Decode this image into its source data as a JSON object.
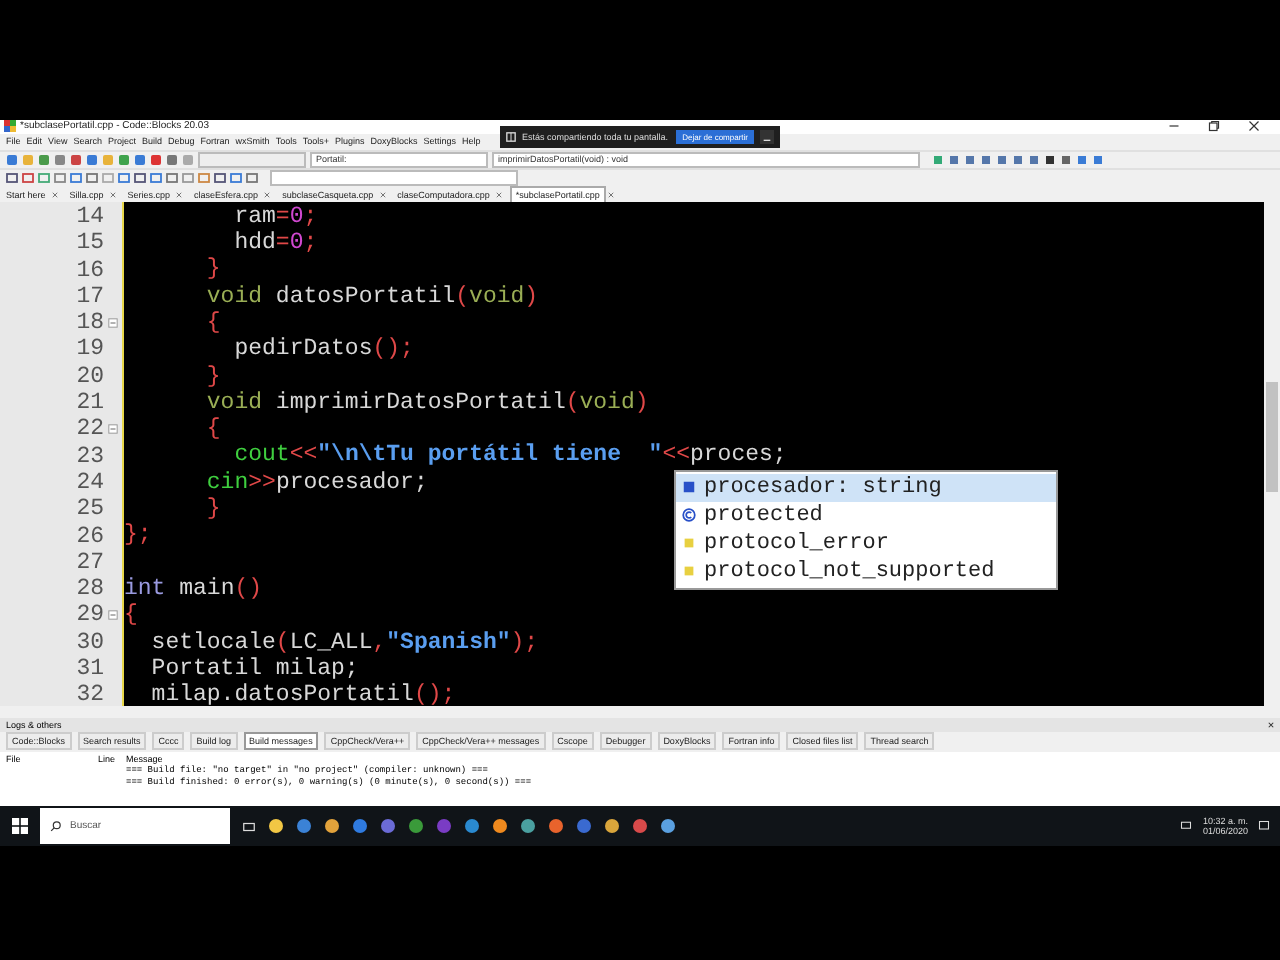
{
  "share_banner": {
    "message": "Estás compartiendo toda tu pantalla.",
    "stop_button": "Dejar de compartir"
  },
  "window": {
    "title": "*subclasePortatil.cpp - Code::Blocks 20.03"
  },
  "menu": [
    "File",
    "Edit",
    "View",
    "Search",
    "Project",
    "Build",
    "Debug",
    "Fortran",
    "wxSmith",
    "Tools",
    "Tools+",
    "Plugins",
    "DoxyBlocks",
    "Settings",
    "Help"
  ],
  "toolbar": {
    "scope": "Portatil:",
    "symbol": "imprimirDatosPortatil(void) : void"
  },
  "tabs": [
    {
      "label": "Start here",
      "selected": false
    },
    {
      "label": "Silla.cpp",
      "selected": false
    },
    {
      "label": "Series.cpp",
      "selected": false
    },
    {
      "label": "claseEsfera.cpp",
      "selected": false
    },
    {
      "label": "subclaseCasqueta.cpp",
      "selected": false
    },
    {
      "label": "claseComputadora.cpp",
      "selected": false
    },
    {
      "label": "*subclasePortatil.cpp",
      "selected": true
    }
  ],
  "editor": {
    "lines": [
      {
        "number": "14",
        "fold": false,
        "tokens": [
          {
            "text": "        ram",
            "kind": "plain"
          },
          {
            "text": "=",
            "kind": "op"
          },
          {
            "text": "0",
            "kind": "number"
          },
          {
            "text": ";",
            "kind": "op"
          }
        ]
      },
      {
        "number": "15",
        "fold": false,
        "tokens": [
          {
            "text": "        hdd",
            "kind": "plain"
          },
          {
            "text": "=",
            "kind": "op"
          },
          {
            "text": "0",
            "kind": "number"
          },
          {
            "text": ";",
            "kind": "op"
          }
        ]
      },
      {
        "number": "16",
        "fold": false,
        "tokens": [
          {
            "text": "      }",
            "kind": "op"
          }
        ]
      },
      {
        "number": "17",
        "fold": false,
        "tokens": [
          {
            "text": "      void",
            "kind": "keyword"
          },
          {
            "text": " datosPortatil",
            "kind": "plain"
          },
          {
            "text": "(",
            "kind": "op"
          },
          {
            "text": "void",
            "kind": "keyword"
          },
          {
            "text": ")",
            "kind": "op"
          }
        ]
      },
      {
        "number": "18",
        "fold": true,
        "tokens": [
          {
            "text": "      {",
            "kind": "op"
          }
        ]
      },
      {
        "number": "19",
        "fold": false,
        "tokens": [
          {
            "text": "        pedirDatos",
            "kind": "plain"
          },
          {
            "text": "();",
            "kind": "op"
          }
        ]
      },
      {
        "number": "20",
        "fold": false,
        "tokens": [
          {
            "text": "      }",
            "kind": "op"
          }
        ]
      },
      {
        "number": "21",
        "fold": false,
        "tokens": [
          {
            "text": "      void",
            "kind": "keyword"
          },
          {
            "text": " imprimirDatosPortatil",
            "kind": "plain"
          },
          {
            "text": "(",
            "kind": "op"
          },
          {
            "text": "void",
            "kind": "keyword"
          },
          {
            "text": ")",
            "kind": "op"
          }
        ]
      },
      {
        "number": "22",
        "fold": true,
        "tokens": [
          {
            "text": "      {",
            "kind": "op"
          }
        ]
      },
      {
        "number": "23",
        "fold": false,
        "tokens": [
          {
            "text": "        cout",
            "kind": "stream"
          },
          {
            "text": "<<",
            "kind": "op"
          },
          {
            "text": "\"",
            "kind": "string"
          },
          {
            "text": "\\n\\t",
            "kind": "escape"
          },
          {
            "text": "Tu portátil tiene  \"",
            "kind": "string"
          },
          {
            "text": "<<",
            "kind": "op"
          },
          {
            "text": "proces;",
            "kind": "plain"
          }
        ]
      },
      {
        "number": "24",
        "fold": false,
        "tokens": [
          {
            "text": "      cin",
            "kind": "stream"
          },
          {
            "text": ">>",
            "kind": "op"
          },
          {
            "text": "procesador;",
            "kind": "plain"
          }
        ]
      },
      {
        "number": "25",
        "fold": false,
        "tokens": [
          {
            "text": "      }",
            "kind": "op"
          }
        ]
      },
      {
        "number": "26",
        "fold": false,
        "tokens": [
          {
            "text": "};",
            "kind": "op"
          }
        ]
      },
      {
        "number": "27",
        "fold": false
      },
      {
        "number": "28",
        "fold": false,
        "tokens": [
          {
            "text": "int",
            "kind": "type"
          },
          {
            "text": " main",
            "kind": "plain"
          },
          {
            "text": "()",
            "kind": "op"
          }
        ]
      },
      {
        "number": "29",
        "fold": true,
        "tokens": [
          {
            "text": "{",
            "kind": "op"
          }
        ]
      },
      {
        "number": "30",
        "fold": false,
        "tokens": [
          {
            "text": "  setlocale",
            "kind": "plain"
          },
          {
            "text": "(",
            "kind": "op"
          },
          {
            "text": "LC_ALL",
            "kind": "plain"
          },
          {
            "text": ",",
            "kind": "op"
          },
          {
            "text": "\"Spanish\"",
            "kind": "string"
          },
          {
            "text": ");",
            "kind": "op"
          }
        ]
      },
      {
        "number": "31",
        "fold": false,
        "tokens": [
          {
            "text": "  Portatil milap;",
            "kind": "plain"
          }
        ]
      },
      {
        "number": "32",
        "fold": false,
        "tokens": [
          {
            "text": "  milap.datosPortatil",
            "kind": "plain"
          },
          {
            "text": "();",
            "kind": "op"
          }
        ]
      }
    ]
  },
  "autocomplete": [
    {
      "label": "procesador: string",
      "kind": "variable",
      "selected": true
    },
    {
      "label": "protected",
      "kind": "class",
      "selected": false
    },
    {
      "label": "protocol_error",
      "kind": "enum",
      "selected": false
    },
    {
      "label": "protocol_not_supported",
      "kind": "enum",
      "selected": false
    }
  ],
  "logs": {
    "title": "Logs & others",
    "tabs": [
      {
        "label": "Code::Blocks",
        "selected": false
      },
      {
        "label": "Search results",
        "selected": false
      },
      {
        "label": "Cccc",
        "selected": false
      },
      {
        "label": "Build log",
        "selected": false
      },
      {
        "label": "Build messages",
        "selected": true
      },
      {
        "label": "CppCheck/Vera++",
        "selected": false
      },
      {
        "label": "CppCheck/Vera++ messages",
        "selected": false
      },
      {
        "label": "Cscope",
        "selected": false
      },
      {
        "label": "Debugger",
        "selected": false
      },
      {
        "label": "DoxyBlocks",
        "selected": false
      },
      {
        "label": "Fortran info",
        "selected": false
      },
      {
        "label": "Closed files list",
        "selected": false
      },
      {
        "label": "Thread search",
        "selected": false
      }
    ],
    "columns": [
      "File",
      "Line",
      "Message"
    ],
    "rows": [
      {
        "message": "=== Build file: \"no target\" in \"no project\" (compiler: unknown) ==="
      },
      {
        "message": "=== Build finished: 0 error(s), 0 warning(s) (0 minute(s), 0 second(s)) ==="
      }
    ]
  },
  "taskbar": {
    "search_placeholder": "Buscar",
    "time": "10:32 a. m.",
    "date": "01/06/2020"
  }
}
